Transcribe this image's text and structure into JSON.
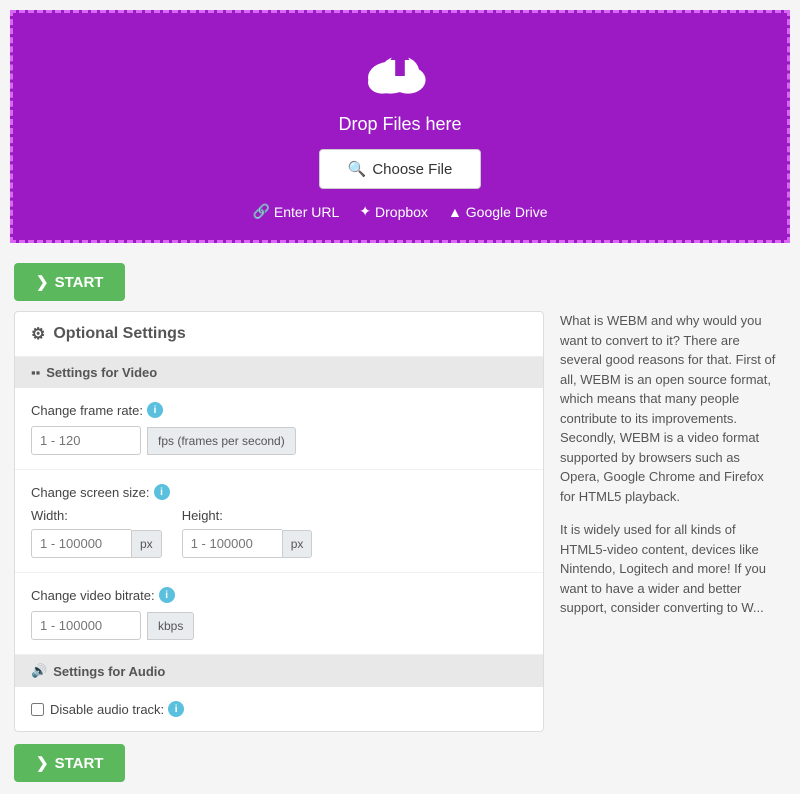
{
  "dropzone": {
    "drop_text": "Drop Files here",
    "choose_file_label": "Choose File",
    "enter_url_label": "Enter URL",
    "dropbox_label": "Dropbox",
    "google_drive_label": "Google Drive",
    "background_color": "#9b1ac4",
    "border_color": "#d966f5"
  },
  "start_button": {
    "label": "START"
  },
  "settings": {
    "title": "Optional Settings",
    "video_section": {
      "header": "Settings for Video",
      "frame_rate": {
        "label": "Change frame rate:",
        "placeholder": "1 - 120",
        "unit": "fps (frames per second)"
      },
      "screen_size": {
        "label": "Change screen size:",
        "width_label": "Width:",
        "width_placeholder": "1 - 100000",
        "width_unit": "px",
        "height_label": "Height:",
        "height_placeholder": "1 - 100000",
        "height_unit": "px"
      },
      "bitrate": {
        "label": "Change video bitrate:",
        "placeholder": "1 - 100000",
        "unit": "kbps"
      }
    },
    "audio_section": {
      "header": "Settings for Audio",
      "disable_audio_label": "Disable audio track:"
    }
  },
  "info_panel": {
    "paragraph1": "What is WEBM and why would you want to convert to it? There are several good reasons for that. First of all, WEBM is an open source format, which means that many people contribute to its improvements. Secondly, WEBM is a video format supported by browsers such as Opera, Google Chrome and Firefox for HTML5 playback.",
    "paragraph2": "It is widely used for all kinds of HTML5-video content, devices like Nintendo, Logitech and more! If you want to have a wider and better support, consider converting to W..."
  }
}
